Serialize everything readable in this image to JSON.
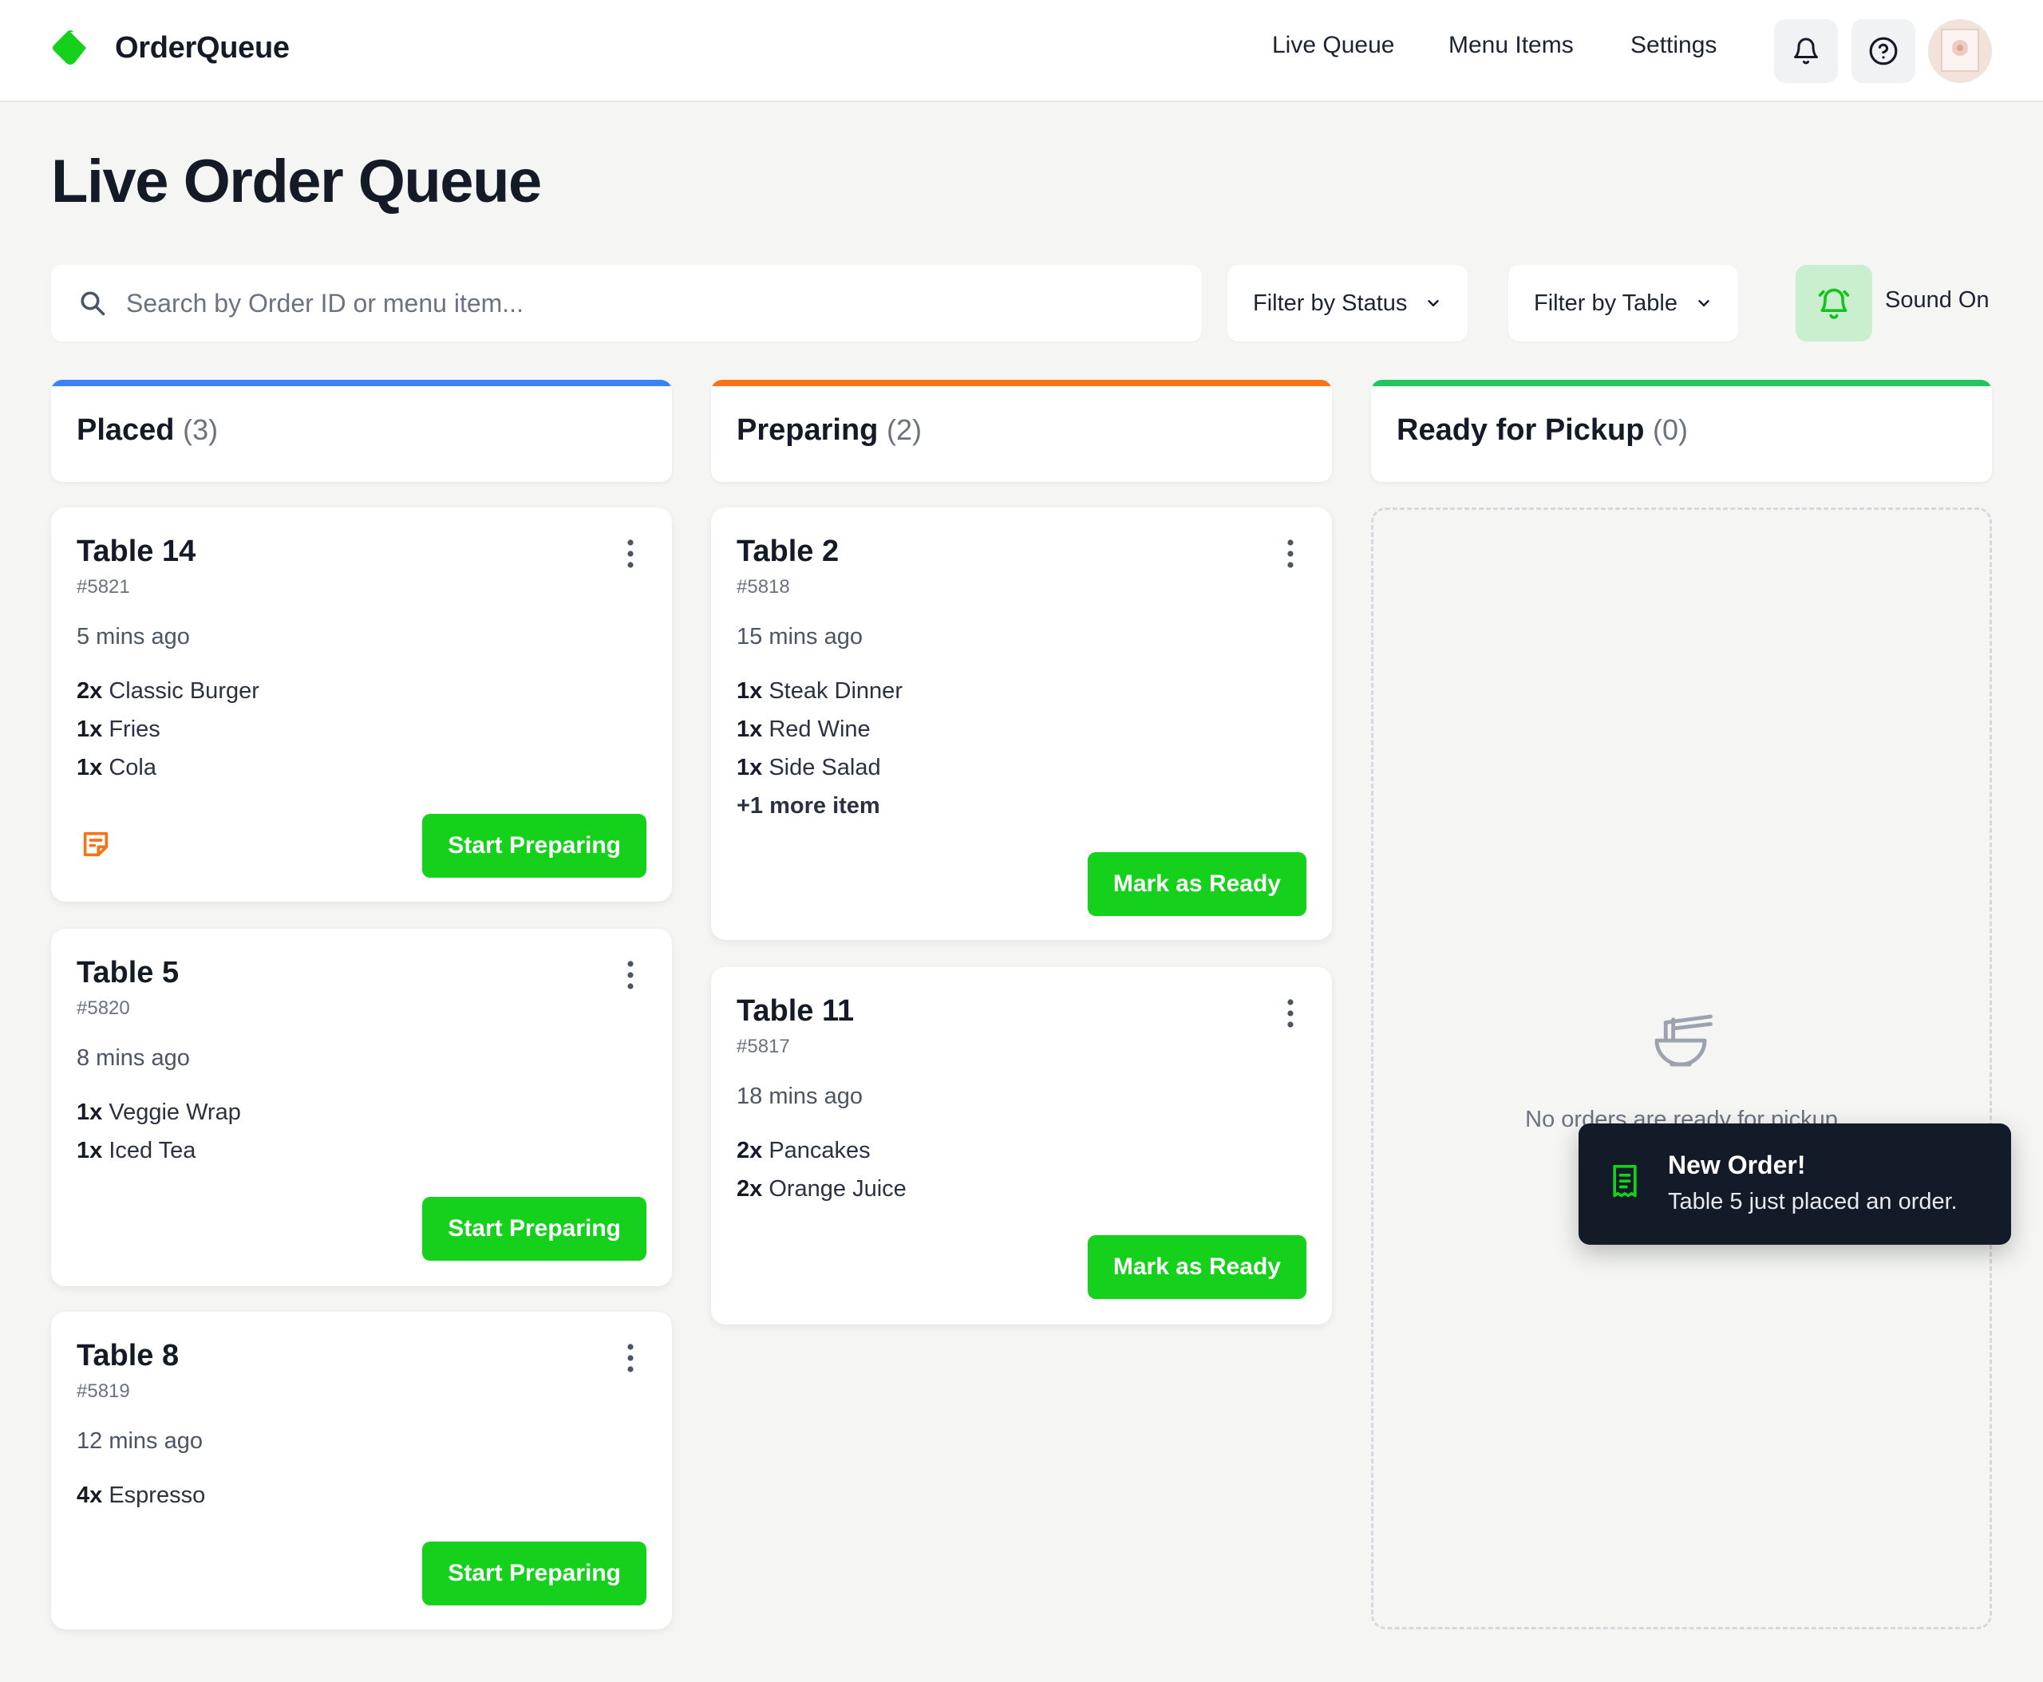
{
  "app": {
    "name": "OrderQueue",
    "brand_color": "#16d11c"
  },
  "nav": {
    "links": [
      "Live Queue",
      "Menu Items",
      "Settings"
    ],
    "icons": [
      "bell-icon",
      "help-icon"
    ]
  },
  "page": {
    "title": "Live Order Queue"
  },
  "toolbar": {
    "search_placeholder": "Search by Order ID or menu item...",
    "filter_status": "Filter by Status",
    "filter_table": "Filter by Table",
    "sound_label": "Sound On"
  },
  "columns": [
    {
      "title": "Placed",
      "count": "(3)",
      "accent": "#3b82f6",
      "orders": [
        {
          "table": "Table 14",
          "id": "#5821",
          "time": "5 mins ago",
          "items": [
            {
              "qty": "2x",
              "name": "Classic Burger"
            },
            {
              "qty": "1x",
              "name": "Fries"
            },
            {
              "qty": "1x",
              "name": "Cola"
            }
          ],
          "has_note": true,
          "action": "Start Preparing"
        },
        {
          "table": "Table 5",
          "id": "#5820",
          "time": "8 mins ago",
          "items": [
            {
              "qty": "1x",
              "name": "Veggie Wrap"
            },
            {
              "qty": "1x",
              "name": "Iced Tea"
            }
          ],
          "action": "Start Preparing"
        },
        {
          "table": "Table 8",
          "id": "#5819",
          "time": "12 mins ago",
          "items": [
            {
              "qty": "4x",
              "name": "Espresso"
            }
          ],
          "action": "Start Preparing"
        }
      ]
    },
    {
      "title": "Preparing",
      "count": "(2)",
      "accent": "#f97316",
      "orders": [
        {
          "table": "Table 2",
          "id": "#5818",
          "time": "15 mins ago",
          "items": [
            {
              "qty": "1x",
              "name": "Steak Dinner"
            },
            {
              "qty": "1x",
              "name": "Red Wine"
            },
            {
              "qty": "1x",
              "name": "Side Salad"
            }
          ],
          "more": "+1 more item",
          "action": "Mark as Ready"
        },
        {
          "table": "Table 11",
          "id": "#5817",
          "time": "18 mins ago",
          "items": [
            {
              "qty": "2x",
              "name": "Pancakes"
            },
            {
              "qty": "2x",
              "name": "Orange Juice"
            }
          ],
          "action": "Mark as Ready"
        }
      ]
    },
    {
      "title": "Ready for Pickup",
      "count": "(0)",
      "accent": "#22c55e",
      "empty_text": "No orders are ready for pickup",
      "empty_icon": "bowl-icon"
    }
  ],
  "toast": {
    "title": "New Order!",
    "message": "Table 5 just placed an order.",
    "icon": "receipt-icon"
  }
}
